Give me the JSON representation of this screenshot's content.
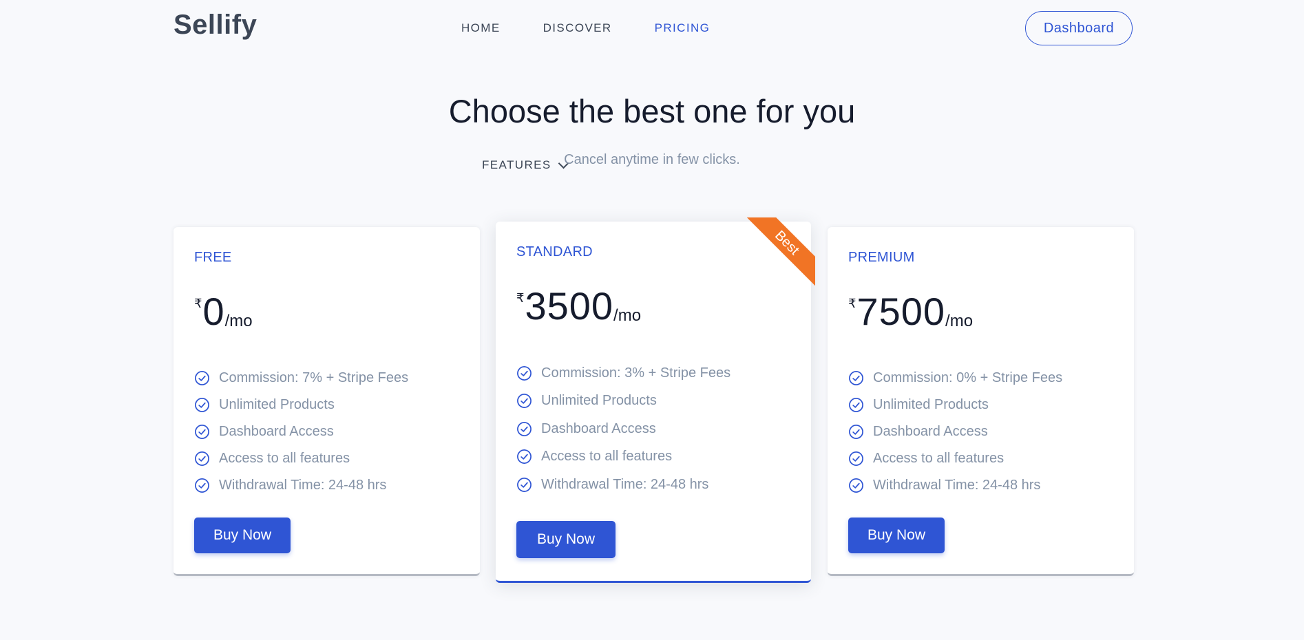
{
  "nav": {
    "logo": "Sellify",
    "links": [
      "HOME",
      "DISCOVER",
      "FEATURES",
      "PRICING"
    ],
    "active": "PRICING",
    "dashboard_label": "Dashboard"
  },
  "hero": {
    "title": "Choose the best one for you",
    "subtitle": "Cancel anytime in few clicks."
  },
  "plans": [
    {
      "name": "FREE",
      "currency": "₹",
      "amount": "0",
      "period": "/mo",
      "features": [
        "Commission: 7% + Stripe Fees",
        "Unlimited Products",
        "Dashboard Access",
        "Access to all features",
        "Withdrawal Time: 24-48 hrs"
      ],
      "cta": "Buy Now"
    },
    {
      "name": "STANDARD",
      "currency": "₹",
      "amount": "3500",
      "period": "/mo",
      "ribbon": "Best",
      "features": [
        "Commission: 3% + Stripe Fees",
        "Unlimited Products",
        "Dashboard Access",
        "Access to all features",
        "Withdrawal Time: 24-48 hrs"
      ],
      "cta": "Buy Now"
    },
    {
      "name": "PREMIUM",
      "currency": "₹",
      "amount": "7500",
      "period": "/mo",
      "features": [
        "Commission: 0% + Stripe Fees",
        "Unlimited Products",
        "Dashboard Access",
        "Access to all features",
        "Withdrawal Time: 24-48 hrs"
      ],
      "cta": "Buy Now"
    }
  ],
  "colors": {
    "primary": "#2f55d4",
    "ribbon": "#f17425",
    "muted_text": "#8492a6",
    "heading": "#161c2d",
    "background": "#f8f9fc"
  },
  "icons": {
    "feature": "check-circle-icon",
    "dropdown": "chevron-down-icon"
  }
}
